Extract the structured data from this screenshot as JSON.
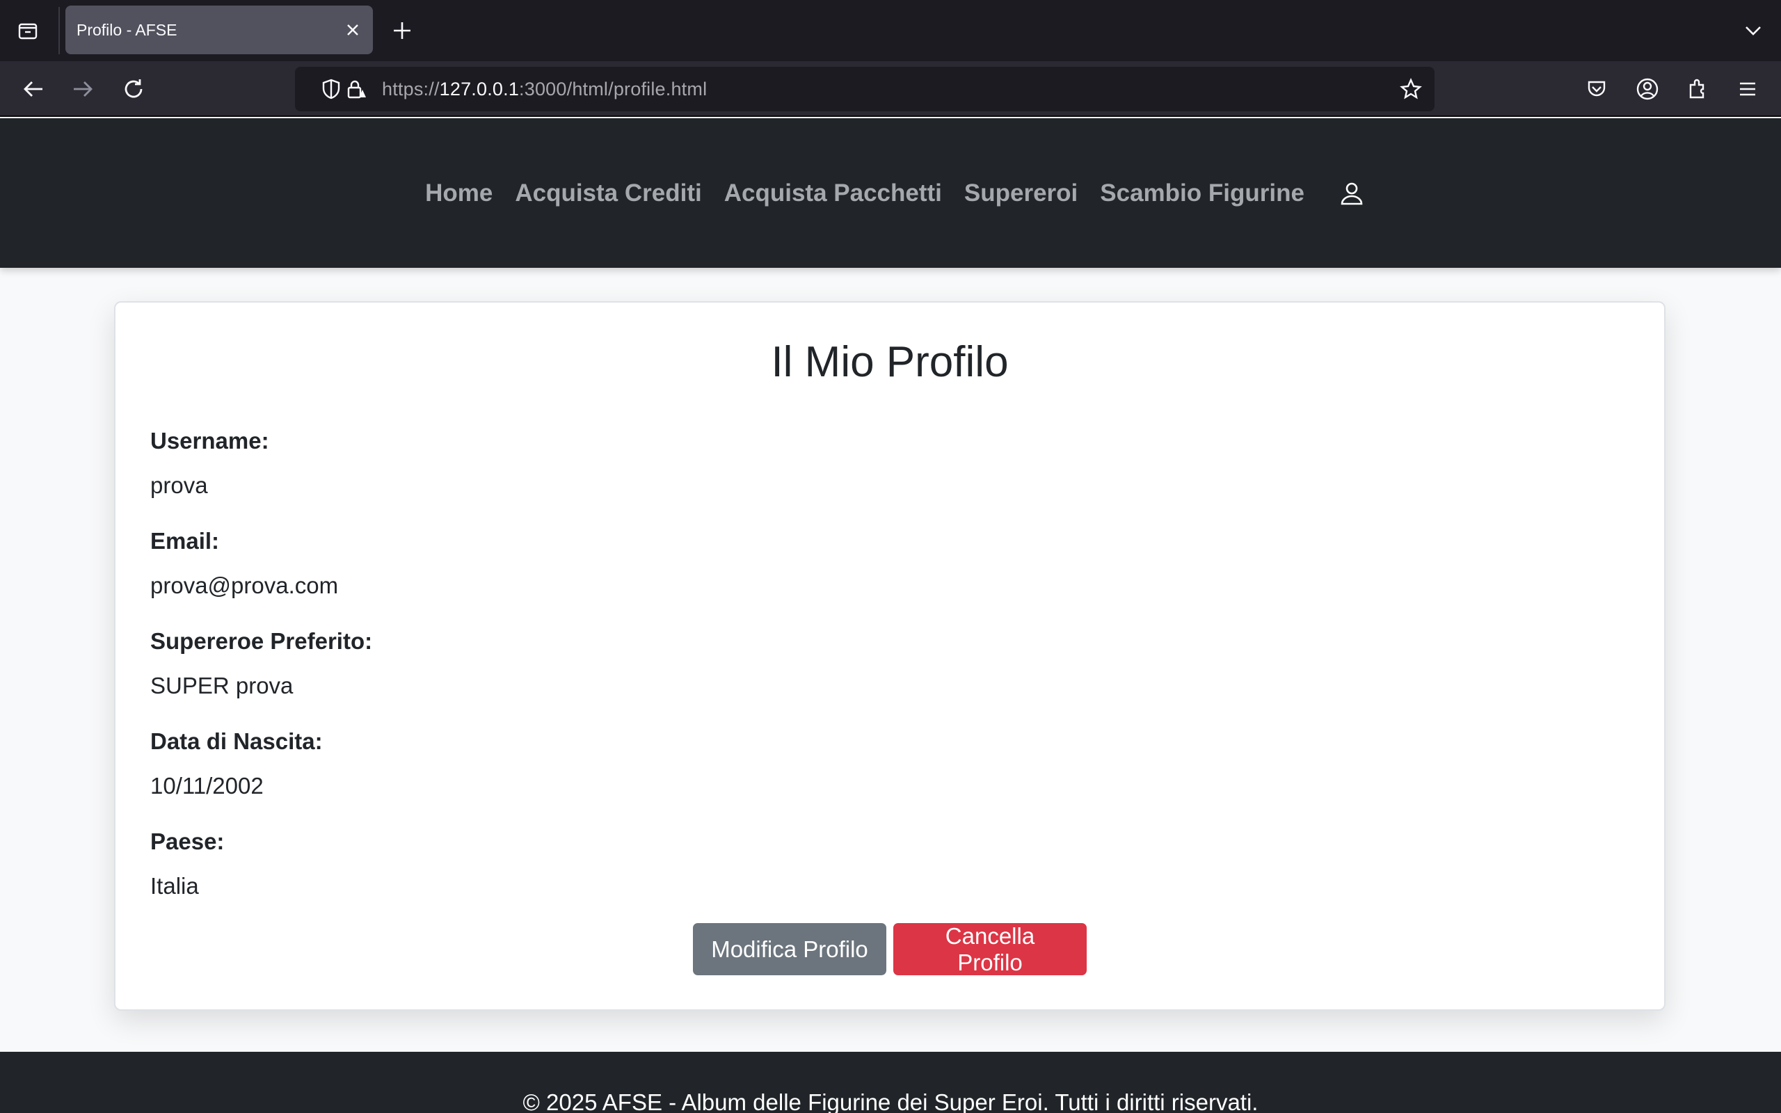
{
  "browser": {
    "tab_title": "Profilo - AFSE",
    "url_scheme": "https://",
    "url_host": "127.0.0.1",
    "url_rest": ":3000/html/profile.html"
  },
  "nav": {
    "items": [
      "Home",
      "Acquista Crediti",
      "Acquista Pacchetti",
      "Supereroi",
      "Scambio Figurine"
    ],
    "user_icon": "user-icon"
  },
  "profile": {
    "title": "Il Mio Profilo",
    "fields": [
      {
        "label": "Username:",
        "value": "prova"
      },
      {
        "label": "Email:",
        "value": "prova@prova.com"
      },
      {
        "label": "Supereroe Preferito:",
        "value": "SUPER prova"
      },
      {
        "label": "Data di Nascita:",
        "value": "10/11/2002"
      },
      {
        "label": "Paese:",
        "value": "Italia"
      }
    ],
    "edit_button": "Modifica Profilo",
    "delete_button": "Cancella Profilo"
  },
  "footer": {
    "text": "© 2025 AFSE - Album delle Figurine dei Super Eroi. Tutti i diritti riservati."
  },
  "colors": {
    "header_bg": "#212529",
    "nav_link": "#a5a9ad",
    "edit_button": "#6c757d",
    "delete_button": "#dc3545"
  }
}
